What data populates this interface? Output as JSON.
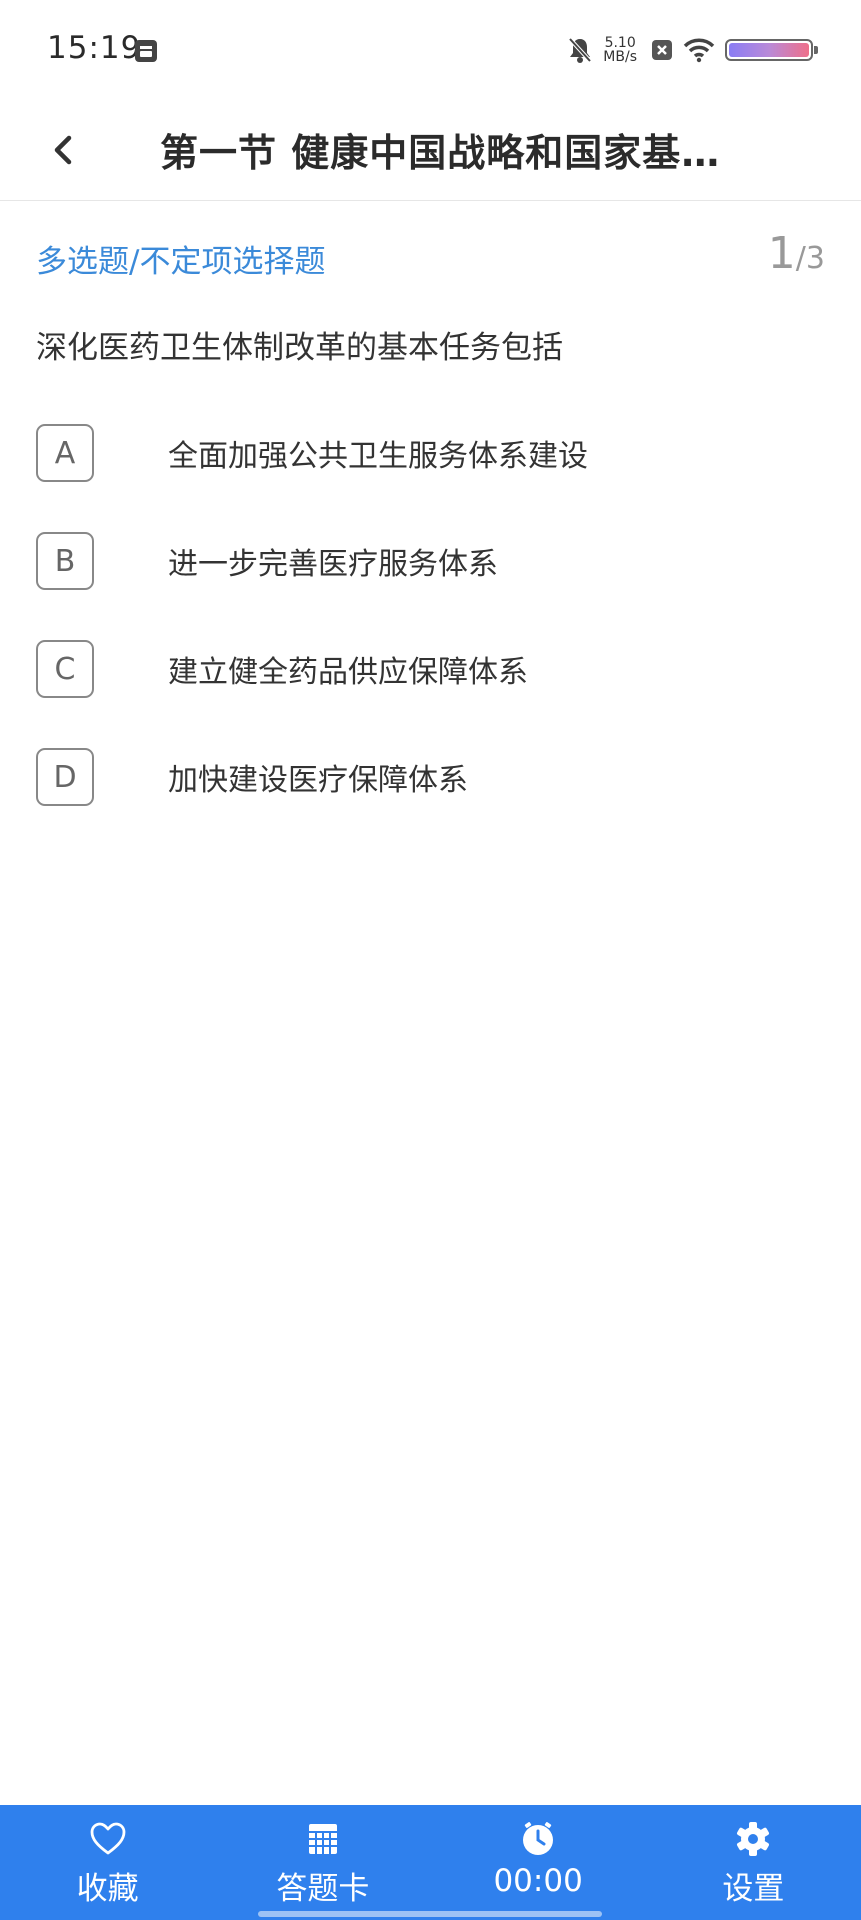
{
  "status_bar": {
    "time": "15:19",
    "net_speed_value": "5.10",
    "net_speed_unit": "MB/s"
  },
  "header": {
    "title": "第一节 健康中国战略和国家基…"
  },
  "question": {
    "type_label": "多选题/不定项选择题",
    "progress_current": "1",
    "progress_separator": "/",
    "progress_total": "3",
    "text": "深化医药卫生体制改革的基本任务包括",
    "options": [
      {
        "letter": "A",
        "text": "全面加强公共卫生服务体系建设"
      },
      {
        "letter": "B",
        "text": "进一步完善医疗服务体系"
      },
      {
        "letter": "C",
        "text": "建立健全药品供应保障体系"
      },
      {
        "letter": "D",
        "text": "加快建设医疗保障体系"
      }
    ]
  },
  "bottom_bar": {
    "favorite_label": "收藏",
    "answer_card_label": "答题卡",
    "timer_label": "00:00",
    "settings_label": "设置"
  },
  "colors": {
    "accent_blue": "#2f80ed",
    "question_type_blue": "#3b8ad9"
  },
  "icons": [
    "app-notification-icon",
    "mute-bell-icon",
    "close-box-icon",
    "wifi-icon",
    "battery-icon",
    "back-chevron-icon",
    "heart-icon",
    "grid-icon",
    "clock-icon",
    "gear-icon"
  ]
}
